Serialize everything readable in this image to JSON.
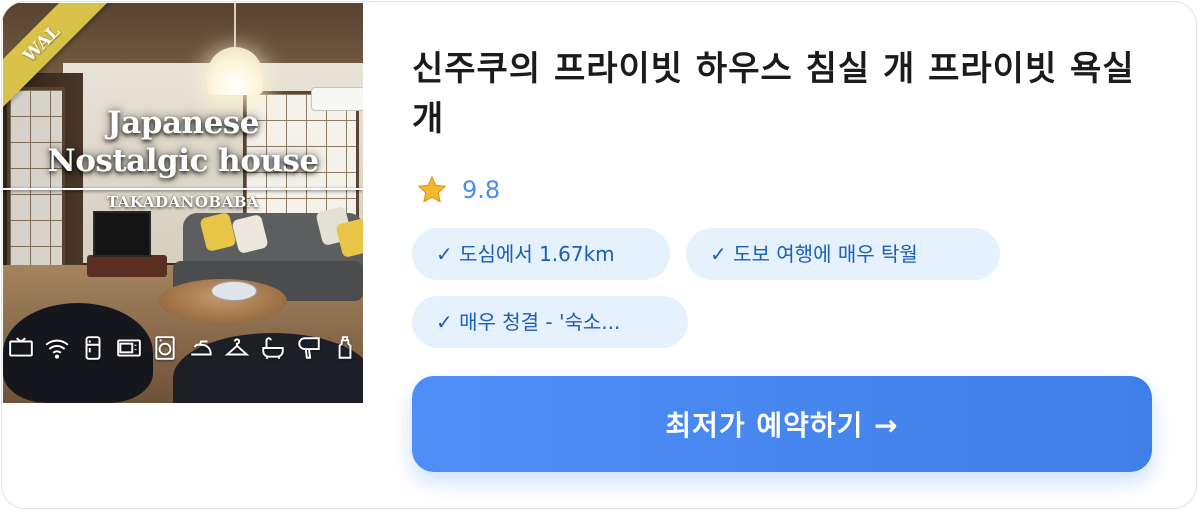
{
  "listing": {
    "photo": {
      "ribbon": "WAL",
      "title_line1": "Japanese",
      "title_line2": "Nostalgic house",
      "title_line3": "TAKADANOBABA",
      "amenity_icons": [
        "tv-icon",
        "wifi-icon",
        "fridge-icon",
        "microwave-icon",
        "washer-icon",
        "iron-icon",
        "hanger-icon",
        "bathtub-icon",
        "hairdryer-icon",
        "bottle-icon"
      ]
    },
    "name": "신주쿠의 프라이빗 하우스 침실 개 프라이빗 욕실 개",
    "rating": "9.8",
    "rating_icon": "star-icon",
    "tags": [
      "✓ 도심에서 1.67km",
      "✓ 도보 여행에 매우 탁월",
      "✓ 매우 청결 - '숙소..."
    ],
    "cta_label": "최저가 예약하기 →",
    "colors": {
      "accent": "#4f8ef6",
      "tag_bg": "#e5f1fc",
      "tag_text": "#1a5fb4",
      "star": "#f5b82e"
    }
  }
}
